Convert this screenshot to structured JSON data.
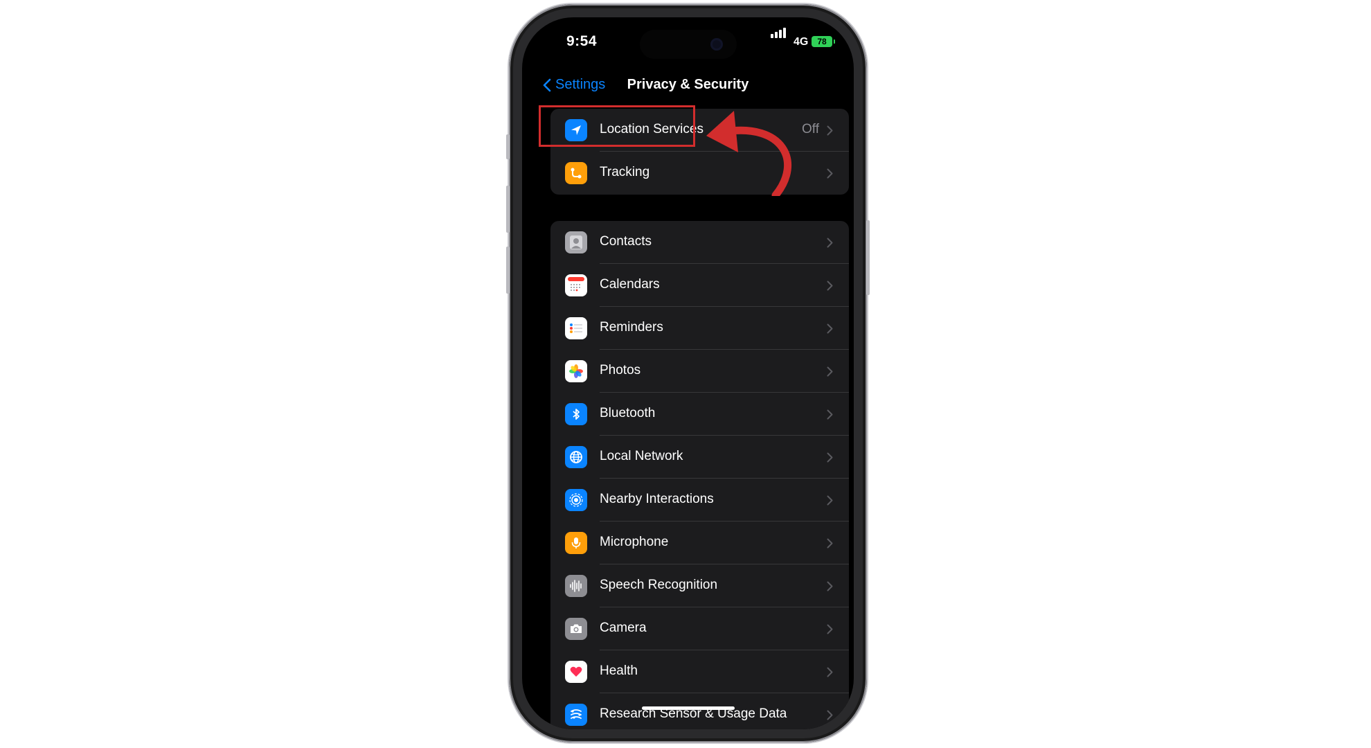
{
  "status_bar": {
    "time": "9:54",
    "network": "4G",
    "battery": "78"
  },
  "nav": {
    "back_label": "Settings",
    "title": "Privacy & Security"
  },
  "top_group": [
    {
      "label": "Location Services",
      "detail": "Off",
      "icon": "location-arrow-icon",
      "color": "#0a84ff"
    },
    {
      "label": "Tracking",
      "detail": "",
      "icon": "tracking-icon",
      "color": "#ff9f0a"
    }
  ],
  "permissions_group": [
    {
      "label": "Contacts",
      "icon": "contacts-icon",
      "color": "#a8a8ad"
    },
    {
      "label": "Calendars",
      "icon": "calendar-icon",
      "color": "#ffffff"
    },
    {
      "label": "Reminders",
      "icon": "reminders-icon",
      "color": "#ffffff"
    },
    {
      "label": "Photos",
      "icon": "photos-icon",
      "color": "#ffffff"
    },
    {
      "label": "Bluetooth",
      "icon": "bluetooth-icon",
      "color": "#0a84ff"
    },
    {
      "label": "Local Network",
      "icon": "globe-icon",
      "color": "#0a84ff"
    },
    {
      "label": "Nearby Interactions",
      "icon": "nearby-icon",
      "color": "#0a84ff"
    },
    {
      "label": "Microphone",
      "icon": "microphone-icon",
      "color": "#ff9f0a"
    },
    {
      "label": "Speech Recognition",
      "icon": "waveform-icon",
      "color": "#8e8e93"
    },
    {
      "label": "Camera",
      "icon": "camera-icon",
      "color": "#8e8e93"
    },
    {
      "label": "Health",
      "icon": "heart-icon",
      "color": "#ffffff"
    },
    {
      "label": "Research Sensor & Usage Data",
      "icon": "research-icon",
      "color": "#0a84ff"
    }
  ],
  "annotation": {
    "highlight_color": "#d22d2d"
  }
}
